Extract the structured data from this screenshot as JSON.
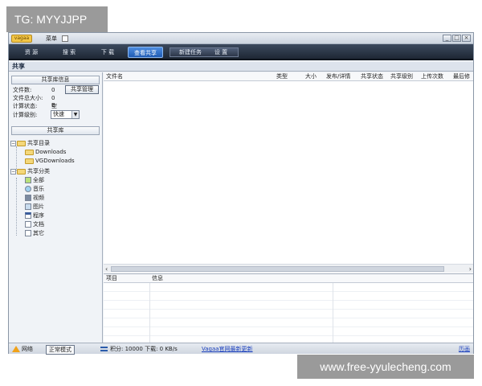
{
  "watermark_top": "TG: MYYJJPP",
  "watermark_bottom": "www.free-yyulecheng.com",
  "app": {
    "logo_text": "vagaa",
    "menu_label": "菜单"
  },
  "nav": {
    "tabs": [
      "资 源",
      "搜 索",
      "下 载",
      "查看共享",
      "新建任务",
      "设 置"
    ],
    "active_index": 3
  },
  "section_title": "共享",
  "left_panel": {
    "info_header": "共享库信息",
    "file_count_label": "文件数:",
    "file_count_value": "0",
    "total_size_label": "文件总大小:",
    "total_size_value": "0 B",
    "calc_status_label": "计算状态:",
    "calc_status_value": "空闲",
    "calc_level_label": "计算级别:",
    "calc_level_value": "快速",
    "manage_button": "共享管理",
    "library_header": "共享库",
    "tree": {
      "dirs_label": "共享目录",
      "dirs": [
        "Downloads",
        "VGDownloads"
      ],
      "cats_label": "共享分类",
      "cats": [
        "全部",
        "音乐",
        "视频",
        "图片",
        "程序",
        "文档",
        "其它"
      ]
    }
  },
  "file_table": {
    "columns": [
      "文件名",
      "类型",
      "大小",
      "发布/详情",
      "共享状态",
      "共享级别",
      "上传次数",
      "最后修"
    ]
  },
  "info_table": {
    "columns": [
      "项目",
      "信息"
    ]
  },
  "statusbar": {
    "network": "网络",
    "mode": "正常模式",
    "stats": "积分: 10000  下载: 0 KB/s",
    "link": "Vagaa官网最新更新",
    "right": "历画"
  },
  "colors": {
    "nav_bg": "#1e2734",
    "active_tab": "#1f5bb3",
    "folder": "#f4d77a"
  }
}
